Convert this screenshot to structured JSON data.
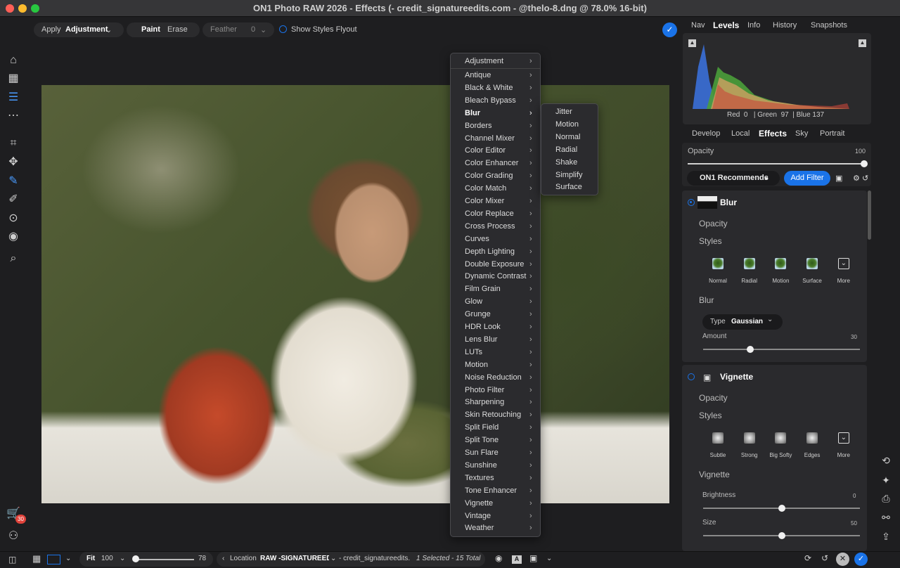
{
  "window": {
    "title": "ON1 Photo RAW 2026 - Effects (- credit_signatureedits.com - @thelo-8.dng @ 78.0% 16-bit)"
  },
  "toolbar": {
    "apply_label": "Apply",
    "adjustment_label": "Adjustment",
    "paint_label": "Paint",
    "erase_label": "Erase",
    "feather_label": "Feather",
    "feather_value": "0",
    "show_styles_label": "Show Styles Flyout"
  },
  "menu": {
    "header": "Adjustment",
    "items": [
      "Antique",
      "Black & White",
      "Bleach Bypass",
      "Blur",
      "Borders",
      "Channel Mixer",
      "Color Editor",
      "Color Enhancer",
      "Color Grading",
      "Color Match",
      "Color Mixer",
      "Color Replace",
      "Cross Process",
      "Curves",
      "Depth Lighting",
      "Double Exposure",
      "Dynamic Contrast",
      "Film Grain",
      "Glow",
      "Grunge",
      "HDR Look",
      "Lens Blur",
      "LUTs",
      "Motion",
      "Noise Reduction",
      "Photo Filter",
      "Sharpening",
      "Skin Retouching",
      "Split Field",
      "Split Tone",
      "Sun Flare",
      "Sunshine",
      "Textures",
      "Tone Enhancer",
      "Vignette",
      "Vintage",
      "Weather"
    ],
    "selected": "Blur"
  },
  "submenu": {
    "items": [
      "Jitter",
      "Motion",
      "Normal",
      "Radial",
      "Shake",
      "Simplify",
      "Surface"
    ]
  },
  "right_tabs": [
    "Nav",
    "Levels",
    "Info",
    "History",
    "Snapshots"
  ],
  "histogram": {
    "red_label": "Red",
    "red_value": "0",
    "green_label": "| Green",
    "green_value": "97",
    "blue_label": "| Blue",
    "blue_value": "137"
  },
  "module_tabs": [
    "Develop",
    "Local",
    "Effects",
    "Sky",
    "Portrait"
  ],
  "opacity": {
    "label": "Opacity",
    "value": "100",
    "level": 1.0
  },
  "recommend": {
    "label": "ON1 Recommends",
    "add_filter": "Add Filter"
  },
  "blur_filter": {
    "title": "Blur",
    "opacity_label": "Opacity",
    "styles_label": "Styles",
    "styles": [
      "Normal",
      "Radial",
      "Motion",
      "Surface",
      "More"
    ],
    "section": "Blur",
    "type_label": "Type",
    "type_value": "Gaussian",
    "amount_label": "Amount",
    "amount_value": "30",
    "amount_level": 0.3
  },
  "vignette_filter": {
    "title": "Vignette",
    "opacity_label": "Opacity",
    "styles_label": "Styles",
    "styles": [
      "Subtle",
      "Strong",
      "Big Softy",
      "Edges",
      "More"
    ],
    "section": "Vignette",
    "brightness_label": "Brightness",
    "brightness_value": "0",
    "brightness_level": 0.5,
    "size_label": "Size",
    "size_value": "50",
    "size_level": 0.5
  },
  "bottom": {
    "fit_label": "Fit",
    "zoom_value": "100",
    "slider_value": "78",
    "location_label": "Location",
    "location_value": "RAW -SIGNATUREED",
    "file_label": "- credit_signatureedits.",
    "selection": "1 Selected - 15 Total",
    "cart_badge": "30"
  },
  "colors": {
    "accent": "#1a73e8",
    "panel": "#2a2a2d",
    "bg": "#1e1e20"
  }
}
